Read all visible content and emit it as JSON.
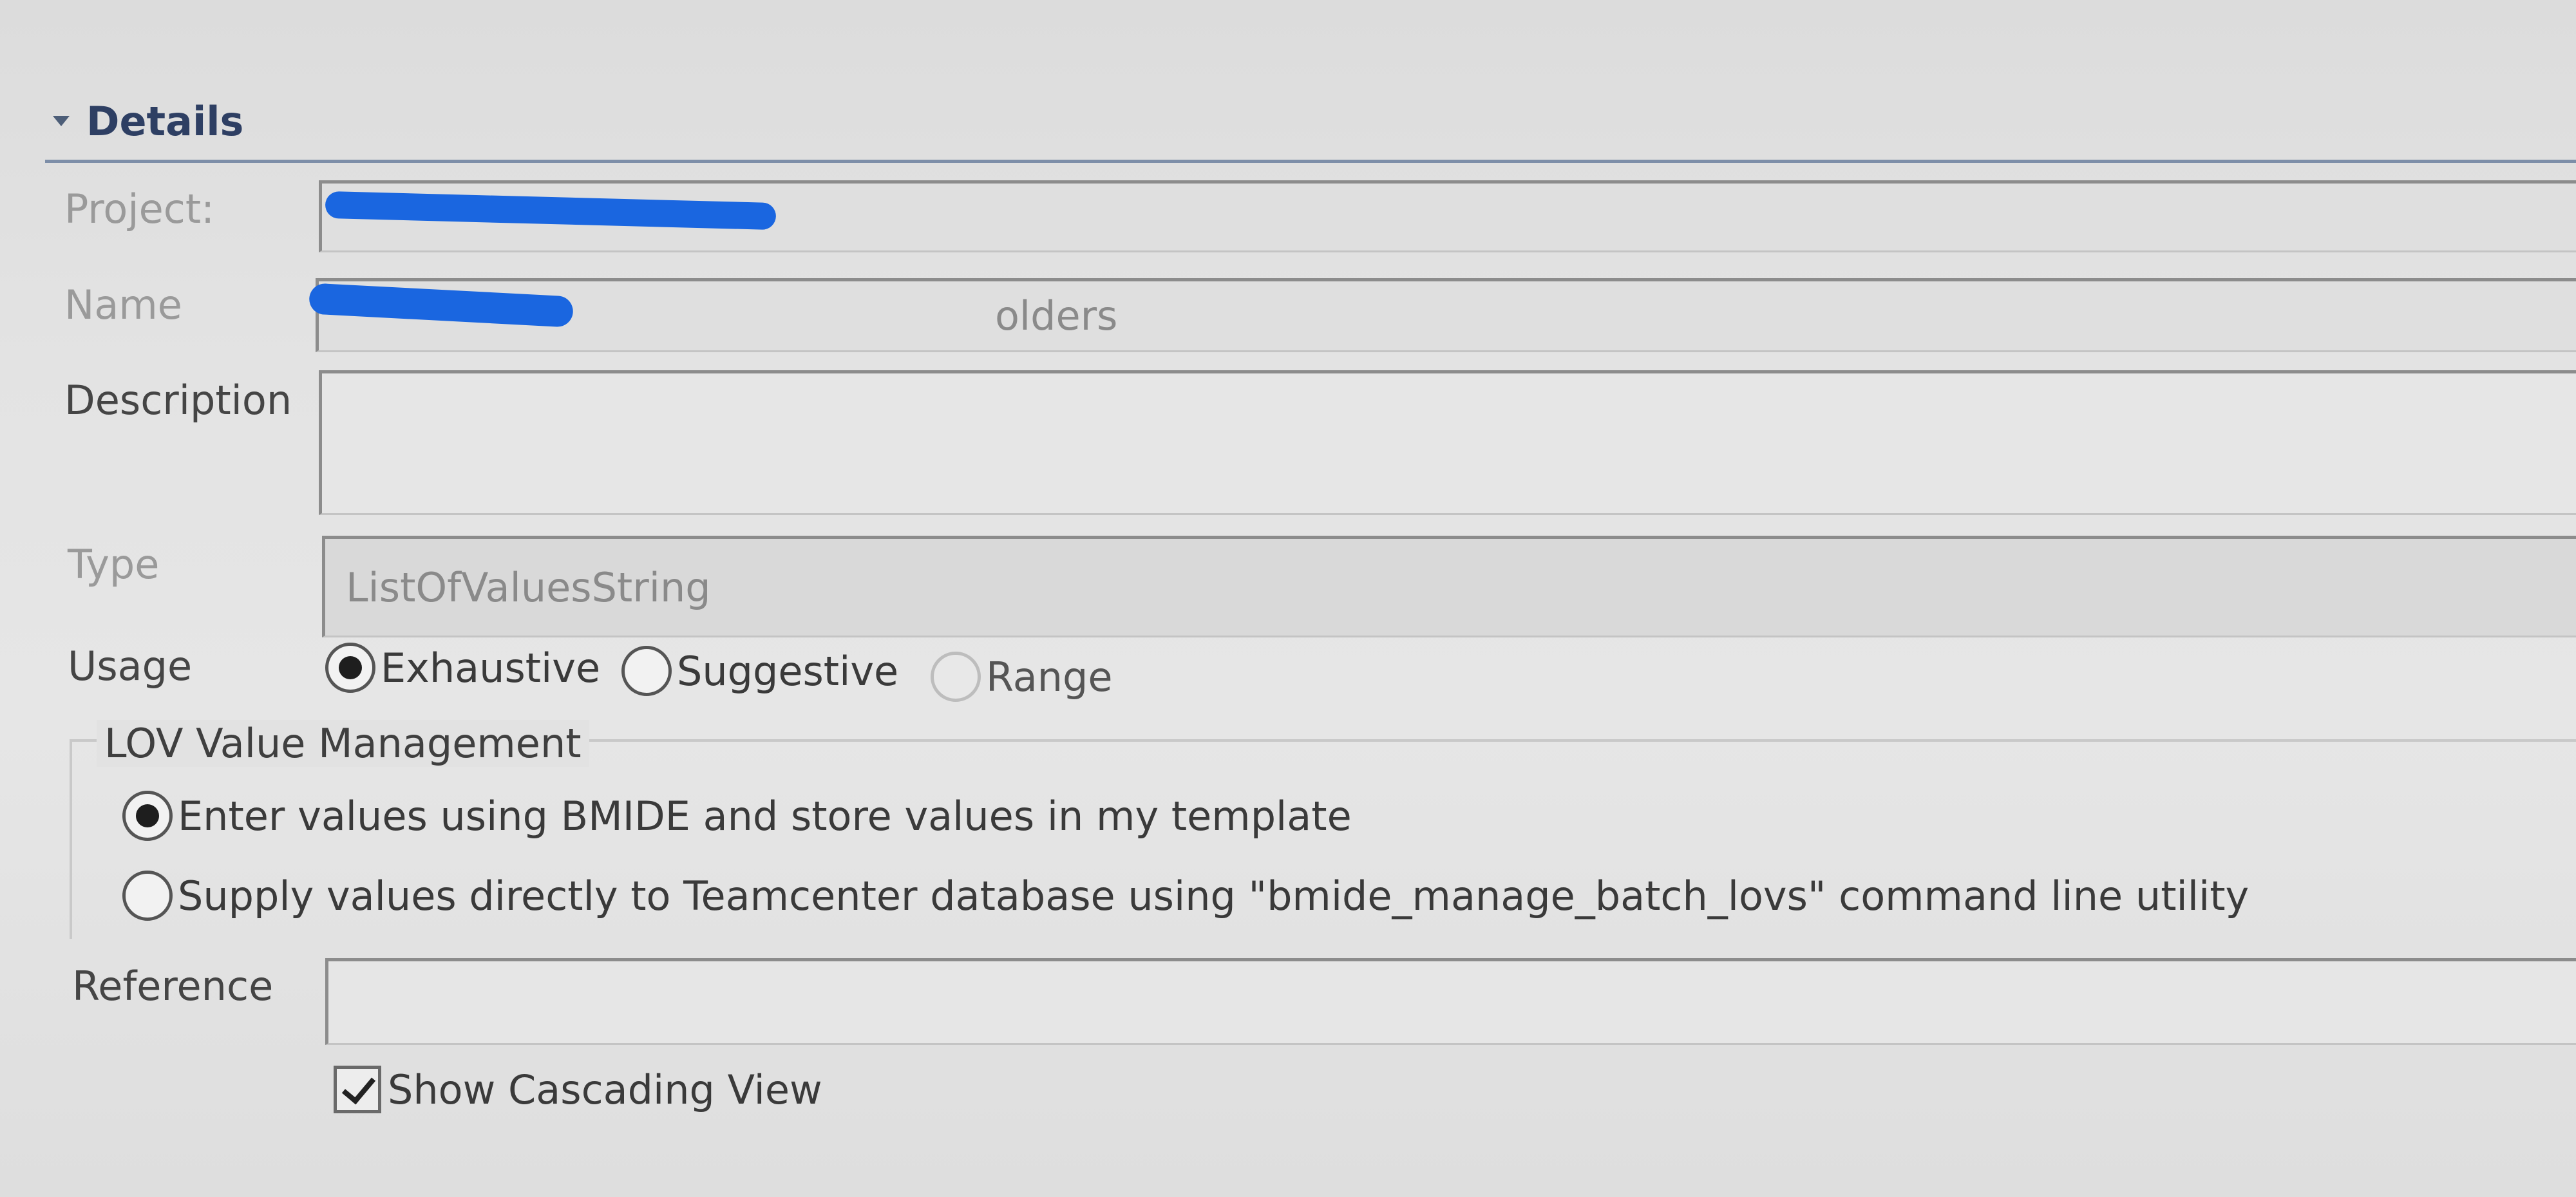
{
  "section": {
    "title": "Details",
    "twisty_icon": "triangle-down-icon"
  },
  "fields": {
    "project": {
      "label": "Project:",
      "value": ""
    },
    "name": {
      "label": "Name",
      "value": "olders"
    },
    "description": {
      "label": "Description",
      "value": ""
    },
    "type": {
      "label": "Type",
      "value": "ListOfValuesString"
    },
    "reference": {
      "label": "Reference",
      "value": ""
    }
  },
  "usage": {
    "label": "Usage",
    "options": [
      {
        "label": "Exhaustive",
        "selected": true
      },
      {
        "label": "Suggestive",
        "selected": false
      },
      {
        "label": "Range",
        "selected": false
      }
    ]
  },
  "lov_group": {
    "title": "LOV Value Management",
    "options": [
      {
        "label": "Enter values using BMIDE and store values in my template",
        "selected": true
      },
      {
        "label": "Supply values directly to Teamcenter database using \"bmide_manage_batch_lovs\" command line utility",
        "selected": false
      }
    ]
  },
  "cascading": {
    "label": "Show Cascading View",
    "checked": true
  },
  "colors": {
    "header_text": "#2e3f63",
    "header_rule": "#7d8ea8",
    "redaction": "#1a66e0"
  }
}
